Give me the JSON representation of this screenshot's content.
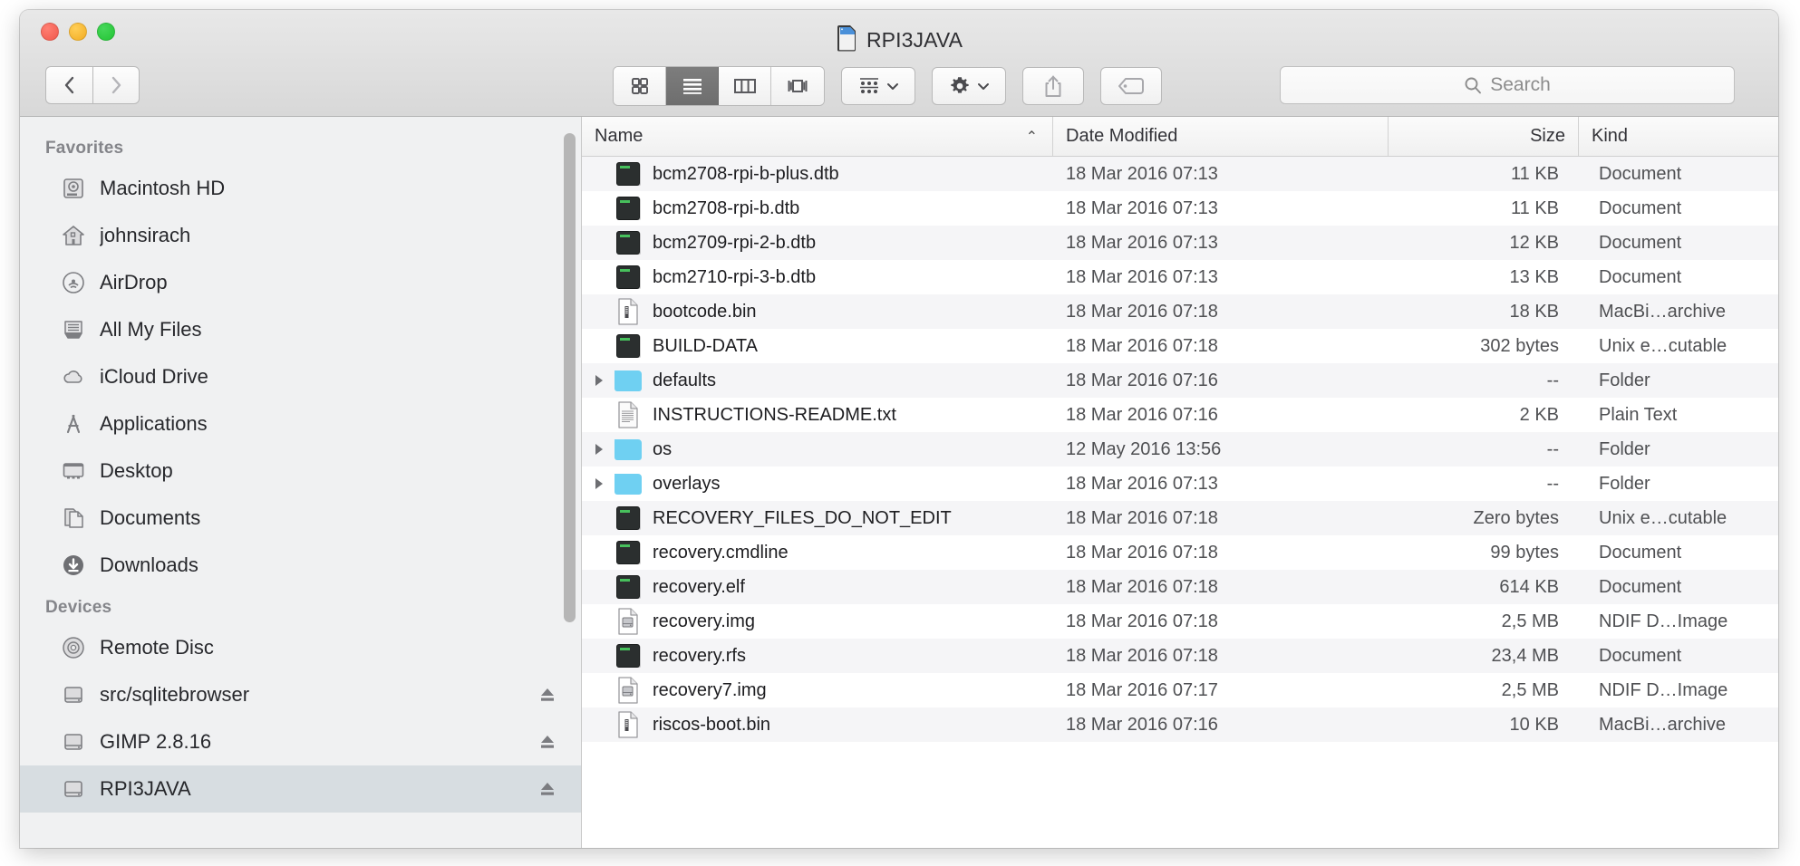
{
  "window": {
    "title": "RPI3JAVA",
    "title_icon": "sd-card-icon",
    "traffic_lights": [
      "close-button",
      "minimize-button",
      "zoom-button"
    ]
  },
  "toolbar": {
    "back_label": "‹",
    "forward_label": "›",
    "view_modes": [
      {
        "name": "icon-view",
        "icon": "grid-icon",
        "active": false
      },
      {
        "name": "list-view",
        "icon": "list-icon",
        "active": true
      },
      {
        "name": "column-view",
        "icon": "columns-icon",
        "active": false
      },
      {
        "name": "coverflow-view",
        "icon": "coverflow-icon",
        "active": false
      }
    ],
    "arrange_button": {
      "name": "arrange-by-button",
      "icon": "arrange-icon"
    },
    "action_button": {
      "name": "action-menu-button",
      "icon": "gear-icon"
    },
    "share_button": {
      "name": "share-button",
      "icon": "share-icon"
    },
    "tag_button": {
      "name": "tag-button",
      "icon": "tag-icon"
    }
  },
  "search": {
    "placeholder": "Search",
    "value": "",
    "icon": "search-icon"
  },
  "sidebar": {
    "sections": [
      {
        "header": "Favorites",
        "items": [
          {
            "label": "Macintosh HD",
            "icon": "hard-disk-icon",
            "eject": false,
            "selected": false
          },
          {
            "label": "johnsirach",
            "icon": "home-icon",
            "eject": false,
            "selected": false
          },
          {
            "label": "AirDrop",
            "icon": "airdrop-icon",
            "eject": false,
            "selected": false
          },
          {
            "label": "All My Files",
            "icon": "all-my-files-icon",
            "eject": false,
            "selected": false
          },
          {
            "label": "iCloud Drive",
            "icon": "cloud-icon",
            "eject": false,
            "selected": false
          },
          {
            "label": "Applications",
            "icon": "applications-icon",
            "eject": false,
            "selected": false
          },
          {
            "label": "Desktop",
            "icon": "desktop-icon",
            "eject": false,
            "selected": false
          },
          {
            "label": "Documents",
            "icon": "documents-icon",
            "eject": false,
            "selected": false
          },
          {
            "label": "Downloads",
            "icon": "downloads-icon",
            "eject": false,
            "selected": false
          }
        ]
      },
      {
        "header": "Devices",
        "items": [
          {
            "label": "Remote Disc",
            "icon": "disc-icon",
            "eject": false,
            "selected": false
          },
          {
            "label": "src/sqlitebrowser",
            "icon": "external-disk-icon",
            "eject": true,
            "selected": false
          },
          {
            "label": "GIMP 2.8.16",
            "icon": "external-disk-icon",
            "eject": true,
            "selected": false
          },
          {
            "label": "RPI3JAVA",
            "icon": "external-disk-icon",
            "eject": true,
            "selected": true
          }
        ]
      }
    ]
  },
  "file_list": {
    "columns": [
      {
        "label": "Name",
        "sort": "ascending",
        "sort_glyph": "⌃"
      },
      {
        "label": "Date Modified",
        "sort": null
      },
      {
        "label": "Size",
        "sort": null
      },
      {
        "label": "Kind",
        "sort": null
      }
    ],
    "rows": [
      {
        "name": "bcm2708-rpi-b-plus.dtb",
        "date": "18 Mar 2016 07:13",
        "size": "11 KB",
        "kind": "Document",
        "icon": "unix-executable-icon",
        "expandable": false
      },
      {
        "name": "bcm2708-rpi-b.dtb",
        "date": "18 Mar 2016 07:13",
        "size": "11 KB",
        "kind": "Document",
        "icon": "unix-executable-icon",
        "expandable": false
      },
      {
        "name": "bcm2709-rpi-2-b.dtb",
        "date": "18 Mar 2016 07:13",
        "size": "12 KB",
        "kind": "Document",
        "icon": "unix-executable-icon",
        "expandable": false
      },
      {
        "name": "bcm2710-rpi-3-b.dtb",
        "date": "18 Mar 2016 07:13",
        "size": "13 KB",
        "kind": "Document",
        "icon": "unix-executable-icon",
        "expandable": false
      },
      {
        "name": "bootcode.bin",
        "date": "18 Mar 2016 07:18",
        "size": "18 KB",
        "kind": "MacBi…archive",
        "icon": "binary-document-icon",
        "expandable": false
      },
      {
        "name": "BUILD-DATA",
        "date": "18 Mar 2016 07:18",
        "size": "302 bytes",
        "kind": "Unix e…cutable",
        "icon": "unix-executable-icon",
        "expandable": false
      },
      {
        "name": "defaults",
        "date": "18 Mar 2016 07:16",
        "size": "--",
        "kind": "Folder",
        "icon": "folder-icon",
        "expandable": true
      },
      {
        "name": "INSTRUCTIONS-README.txt",
        "date": "18 Mar 2016 07:16",
        "size": "2 KB",
        "kind": "Plain Text",
        "icon": "text-document-icon",
        "expandable": false
      },
      {
        "name": "os",
        "date": "12 May 2016 13:56",
        "size": "--",
        "kind": "Folder",
        "icon": "folder-icon",
        "expandable": true
      },
      {
        "name": "overlays",
        "date": "18 Mar 2016 07:13",
        "size": "--",
        "kind": "Folder",
        "icon": "folder-icon",
        "expandable": true
      },
      {
        "name": "RECOVERY_FILES_DO_NOT_EDIT",
        "date": "18 Mar 2016 07:18",
        "size": "Zero bytes",
        "kind": "Unix e…cutable",
        "icon": "unix-executable-icon",
        "expandable": false
      },
      {
        "name": "recovery.cmdline",
        "date": "18 Mar 2016 07:18",
        "size": "99 bytes",
        "kind": "Document",
        "icon": "unix-executable-icon",
        "expandable": false
      },
      {
        "name": "recovery.elf",
        "date": "18 Mar 2016 07:18",
        "size": "614 KB",
        "kind": "Document",
        "icon": "unix-executable-icon",
        "expandable": false
      },
      {
        "name": "recovery.img",
        "date": "18 Mar 2016 07:18",
        "size": "2,5 MB",
        "kind": "NDIF D…Image",
        "icon": "disk-image-icon",
        "expandable": false
      },
      {
        "name": "recovery.rfs",
        "date": "18 Mar 2016 07:18",
        "size": "23,4 MB",
        "kind": "Document",
        "icon": "unix-executable-icon",
        "expandable": false
      },
      {
        "name": "recovery7.img",
        "date": "18 Mar 2016 07:17",
        "size": "2,5 MB",
        "kind": "NDIF D…Image",
        "icon": "disk-image-icon",
        "expandable": false
      },
      {
        "name": "riscos-boot.bin",
        "date": "18 Mar 2016 07:16",
        "size": "10 KB",
        "kind": "MacBi…archive",
        "icon": "binary-document-icon",
        "expandable": false
      }
    ]
  },
  "colors": {
    "selection": "#d7dde1",
    "folder_blue": "#6fd0f2",
    "sidebar_bg": "#f0f1f2",
    "row_alt": "#f5f5f7"
  }
}
